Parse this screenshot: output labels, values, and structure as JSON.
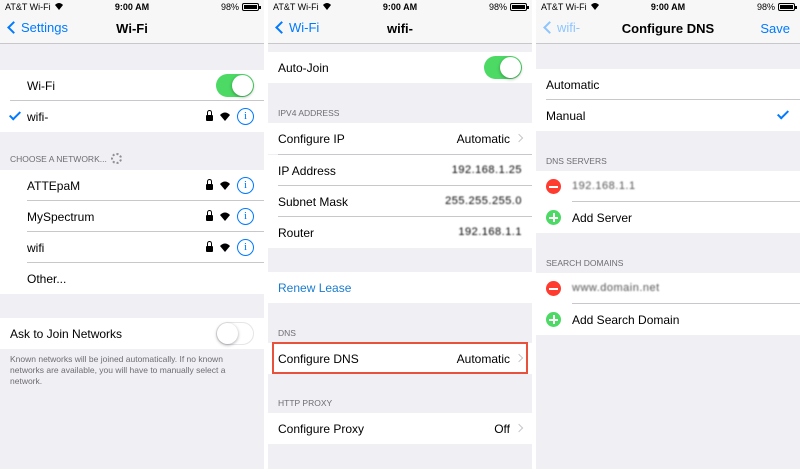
{
  "status_bar": {
    "carrier": "AT&T Wi-Fi",
    "time": "9:00 AM",
    "battery": "98%"
  },
  "screen1": {
    "back_label": "Settings",
    "title": "Wi-Fi",
    "wifi_label": "Wi-Fi",
    "connected_network": "wifi-",
    "choose_header": "CHOOSE A NETWORK...",
    "networks": [
      "ATTEpaM",
      "MySpectrum",
      "wifi"
    ],
    "other_label": "Other...",
    "ask_label": "Ask to Join Networks",
    "ask_footer": "Known networks will be joined automatically. If no known networks are available, you will have to manually select a network."
  },
  "screen2": {
    "back_label": "Wi-Fi",
    "title": "wifi-",
    "auto_join": "Auto-Join",
    "ipv4_header": "IPV4 ADDRESS",
    "configure_ip": "Configure IP",
    "configure_ip_value": "Automatic",
    "ip_address": "IP Address",
    "ip_address_value": "192.168.1.25",
    "subnet_mask": "Subnet Mask",
    "subnet_mask_value": "255.255.255.0",
    "router": "Router",
    "router_value": "192.168.1.1",
    "renew_lease": "Renew Lease",
    "dns_header": "DNS",
    "configure_dns": "Configure DNS",
    "configure_dns_value": "Automatic",
    "proxy_header": "HTTP PROXY",
    "configure_proxy": "Configure Proxy",
    "configure_proxy_value": "Off"
  },
  "screen3": {
    "back_label": "wifi-",
    "title": "Configure DNS",
    "save_label": "Save",
    "automatic": "Automatic",
    "manual": "Manual",
    "dns_servers_header": "DNS SERVERS",
    "dns_server_value": "192.168.1.1",
    "add_server": "Add Server",
    "search_domains_header": "SEARCH DOMAINS",
    "search_domain_value": "www.domain.net",
    "add_search_domain": "Add Search Domain"
  },
  "colors": {
    "accent": "#007aff",
    "toggle_on": "#4cd964",
    "delete": "#ff3b30",
    "highlight": "#e8523c"
  },
  "icons": [
    "wifi-icon",
    "lock-icon",
    "info-icon",
    "checkmark-icon",
    "chevron-right-icon",
    "chevron-left-icon",
    "spinner-icon",
    "minus-circle-icon",
    "plus-circle-icon"
  ]
}
